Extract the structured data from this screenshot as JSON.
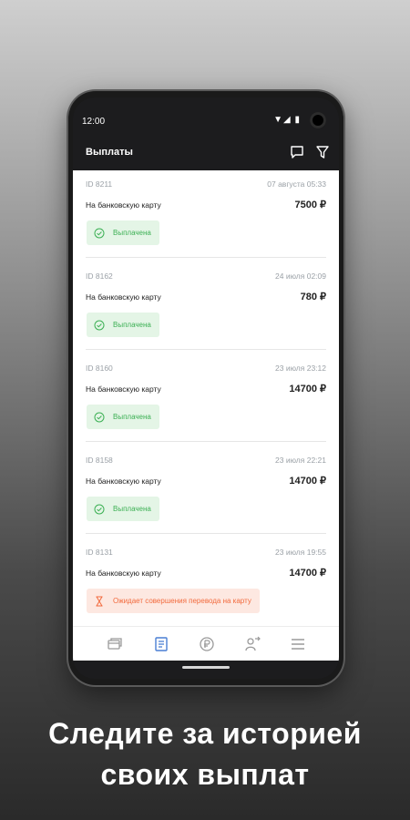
{
  "status_bar": {
    "time": "12:00",
    "icons": "▼◢ ▮"
  },
  "app_bar": {
    "title": "Выплаты"
  },
  "payouts": [
    {
      "id": "ID 8211",
      "date": "07 августа 05:33",
      "method": "На банковскую карту",
      "amount": "7500 ₽",
      "status": "Выплачена",
      "status_type": "paid"
    },
    {
      "id": "ID 8162",
      "date": "24 июля 02:09",
      "method": "На банковскую карту",
      "amount": "780 ₽",
      "status": "Выплачена",
      "status_type": "paid"
    },
    {
      "id": "ID 8160",
      "date": "23 июля 23:12",
      "method": "На банковскую карту",
      "amount": "14700 ₽",
      "status": "Выплачена",
      "status_type": "paid"
    },
    {
      "id": "ID 8158",
      "date": "23 июля 22:21",
      "method": "На банковскую карту",
      "amount": "14700 ₽",
      "status": "Выплачена",
      "status_type": "paid"
    },
    {
      "id": "ID 8131",
      "date": "23 июля 19:55",
      "method": "На банковскую карту",
      "amount": "14700 ₽",
      "status": "Ожидает совершения перевода на карту",
      "status_type": "pending"
    }
  ],
  "bottom_nav": [
    "cards-icon",
    "document-icon",
    "payout-icon",
    "person-transfer-icon",
    "menu-icon"
  ],
  "colors": {
    "paid": "#3cb054",
    "pending": "#f26a3d",
    "active_nav": "#4a7fd4"
  },
  "caption": {
    "line1": "Следите за историей",
    "line2": "своих выплат"
  }
}
